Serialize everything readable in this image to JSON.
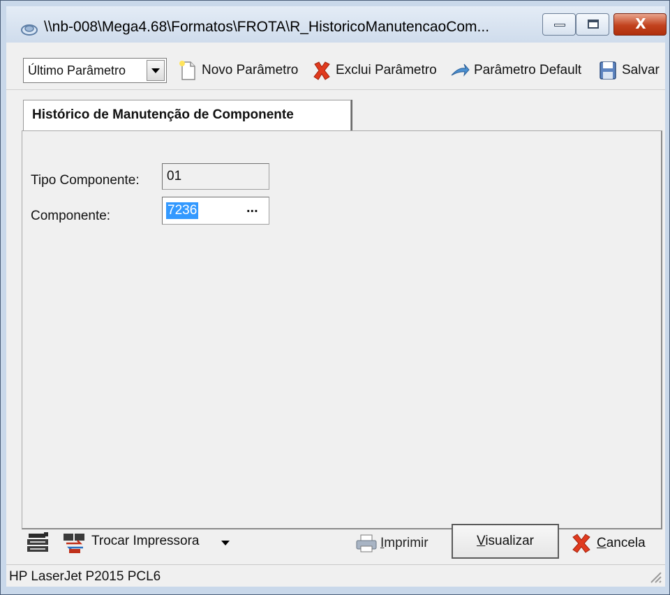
{
  "window": {
    "title": "\\\\nb-008\\Mega4.68\\Formatos\\FROTA\\R_HistoricoManutencaoCom...",
    "close_glyph": "X"
  },
  "toolbar": {
    "parameter_select": {
      "selected": "Último Parâmetro"
    },
    "new_label": "Novo Parâmetro",
    "delete_label": "Exclui Parâmetro",
    "default_label": "Parâmetro Default",
    "save_label": "Salvar"
  },
  "tabs": [
    {
      "label": "Histórico de Manutenção de Componente",
      "active": true
    }
  ],
  "form": {
    "tipo_componente": {
      "label": "Tipo Componente:",
      "value": "01"
    },
    "componente": {
      "label": "Componente:",
      "value": "7236",
      "lookup": "..."
    }
  },
  "actions": {
    "trocar_label": "Trocar Impressora",
    "imprimir_accel": "I",
    "imprimir_rest": "mprimir",
    "visualizar_accel": "V",
    "visualizar_rest": "isualizar",
    "cancela_accel": "C",
    "cancela_rest": "ancela"
  },
  "status": {
    "printer": "HP LaserJet P2015 PCL6"
  },
  "colors": {
    "selection": "#3399ff",
    "close_button": "#c2421d",
    "window_bg": "#f0f0f0"
  },
  "icons": {
    "app": "app-icon",
    "new": "new-document-icon",
    "delete": "red-x-icon",
    "default": "arrow-icon",
    "save": "floppy-disk-icon",
    "printer_setup": "printer-icon",
    "swap_printer": "swap-printer-icon",
    "print": "printer-icon",
    "cancel": "red-x-icon"
  }
}
